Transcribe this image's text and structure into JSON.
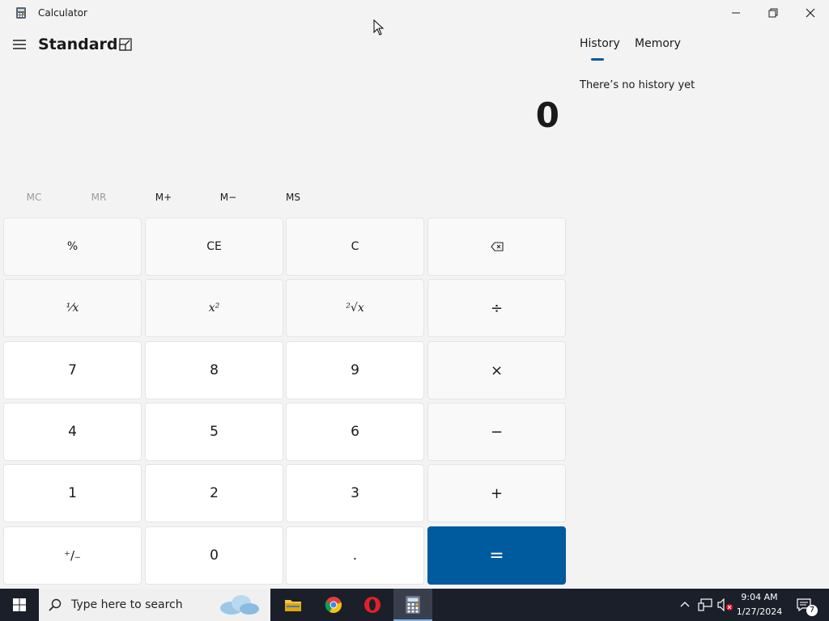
{
  "window": {
    "title": "Calculator"
  },
  "header": {
    "mode": "Standard"
  },
  "display": {
    "value": "0"
  },
  "memory_buttons": [
    {
      "label": "MC",
      "enabled": false
    },
    {
      "label": "MR",
      "enabled": false
    },
    {
      "label": "M+",
      "enabled": true
    },
    {
      "label": "M−",
      "enabled": true
    },
    {
      "label": "MS",
      "enabled": true
    }
  ],
  "keys": {
    "percent": "%",
    "ce": "CE",
    "c": "C",
    "reciprocal": "⅟x",
    "square": "x²",
    "sqrt": "²√x",
    "divide": "÷",
    "seven": "7",
    "eight": "8",
    "nine": "9",
    "multiply": "×",
    "four": "4",
    "five": "5",
    "six": "6",
    "minus": "−",
    "one": "1",
    "two": "2",
    "three": "3",
    "plus": "+",
    "negate": "⁺/₋",
    "zero": "0",
    "decimal": ".",
    "equals": "="
  },
  "panel": {
    "tabs": [
      "History",
      "Memory"
    ],
    "active_tab": "History",
    "empty_text": "There’s no history yet"
  },
  "taskbar": {
    "search_placeholder": "Type here to search",
    "time": "9:04 AM",
    "date": "1/27/2024",
    "notification_count": "7"
  },
  "colors": {
    "accent": "#005a9e",
    "background": "#f3f3f3",
    "taskbar": "#1b1f2a"
  }
}
